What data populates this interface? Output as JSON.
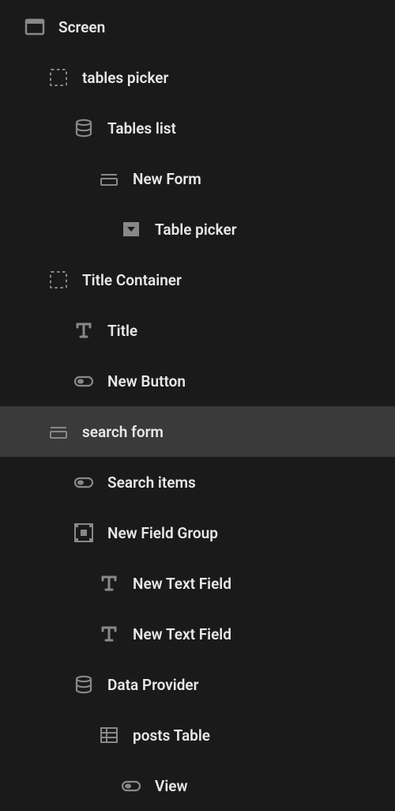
{
  "tree": [
    {
      "label": "Screen",
      "icon": "screen",
      "depth": 0,
      "selected": false
    },
    {
      "label": "tables picker",
      "icon": "container",
      "depth": 1,
      "selected": false
    },
    {
      "label": "Tables list",
      "icon": "database",
      "depth": 2,
      "selected": false
    },
    {
      "label": "New Form",
      "icon": "form",
      "depth": 3,
      "selected": false
    },
    {
      "label": "Table picker",
      "icon": "dropdown",
      "depth": 4,
      "selected": false
    },
    {
      "label": "Title Container",
      "icon": "container",
      "depth": 1,
      "selected": false
    },
    {
      "label": "Title",
      "icon": "text",
      "depth": 2,
      "selected": false
    },
    {
      "label": "New Button",
      "icon": "button",
      "depth": 2,
      "selected": false
    },
    {
      "label": "search form",
      "icon": "form",
      "depth": 1,
      "selected": true
    },
    {
      "label": "Search items",
      "icon": "button",
      "depth": 2,
      "selected": false
    },
    {
      "label": "New Field Group",
      "icon": "fieldgroup",
      "depth": 2,
      "selected": false
    },
    {
      "label": "New Text Field",
      "icon": "text",
      "depth": 3,
      "selected": false
    },
    {
      "label": "New Text Field",
      "icon": "text",
      "depth": 3,
      "selected": false
    },
    {
      "label": "Data Provider",
      "icon": "database",
      "depth": 2,
      "selected": false
    },
    {
      "label": "posts Table",
      "icon": "table",
      "depth": 3,
      "selected": false
    },
    {
      "label": "View",
      "icon": "button",
      "depth": 4,
      "selected": false
    }
  ]
}
